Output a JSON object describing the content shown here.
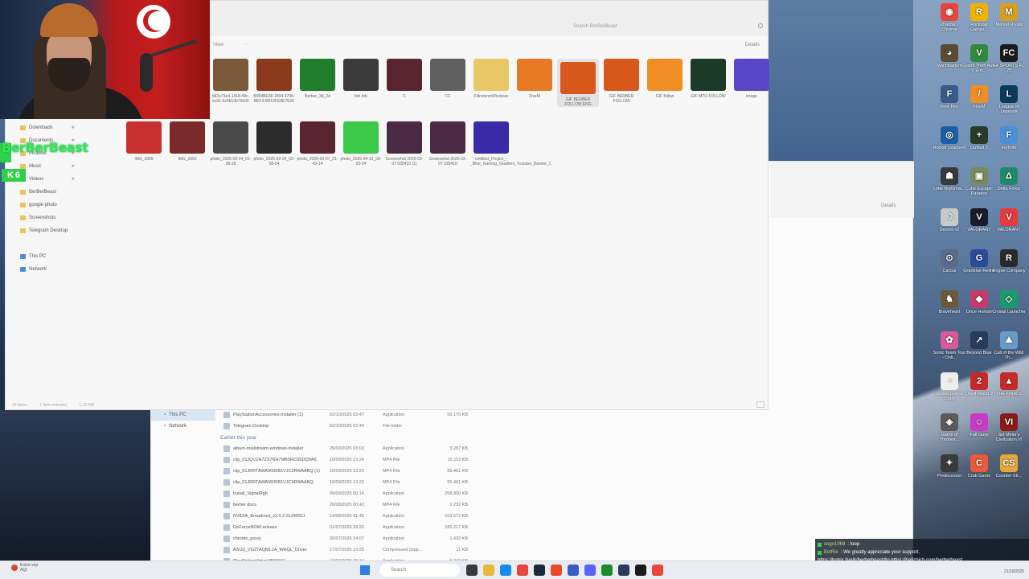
{
  "webcam": {
    "label": "streamer webcam"
  },
  "stream_overlay": {
    "name": "BerBerBeast",
    "count": "6"
  },
  "front_window": {
    "search_placeholder": "Search BerBerBeast",
    "toolbar": {
      "view": "View",
      "more": "···",
      "details": "Details"
    },
    "nav": [
      {
        "label": "Downloads",
        "pinned": true
      },
      {
        "label": "Documents",
        "pinned": true
      },
      {
        "label": "Pictures",
        "pinned": true
      },
      {
        "label": "Music",
        "pinned": true
      },
      {
        "label": "Videos",
        "pinned": true
      },
      {
        "label": "BerBerBeast",
        "pinned": false
      },
      {
        "label": "google photo",
        "pinned": false
      },
      {
        "label": "Screenshots",
        "pinned": false
      },
      {
        "label": "Telegram Desktop",
        "pinned": false
      }
    ],
    "nav_pc": "This PC",
    "nav_network": "Network",
    "status": {
      "items": "23 items",
      "selected": "1 item selected",
      "size": "1,16 MB"
    },
    "files_row1": [
      {
        "name": "b82e73e4-1418-49c-bc01-6c6b13b79b36",
        "color": "#7a5a3a"
      },
      {
        "name": "B094BE58-1504-4706-BEF3-8D10FE8E7E20",
        "color": "#8c3a1c"
      },
      {
        "name": "Berber_3d_2d",
        "color": "#1f7d2c"
      },
      {
        "name": "brb brb",
        "color": "#3a3a3a"
      },
      {
        "name": "C",
        "color": "#5a2430"
      },
      {
        "name": "CC",
        "color": "#606060"
      },
      {
        "name": "FiltrerenmWindows",
        "color": "#e9c766"
      },
      {
        "name": "FiveM",
        "color": "#e87a25"
      },
      {
        "name": "GIF BERBER FOLLOW ENG",
        "color": "#d8581c"
      },
      {
        "name": "GIF BERBER FOLLOW",
        "color": "#d8581c"
      },
      {
        "name": "GIF follow",
        "color": "#f08d24"
      },
      {
        "name": "GIF MTO FOLLOW",
        "color": "#1b3a28"
      },
      {
        "name": "image",
        "color": "#5a46c8"
      }
    ],
    "files_row2": [
      {
        "name": "IMG_2009",
        "color": "#c93030"
      },
      {
        "name": "IMG_2662",
        "color": "#7a2a2a"
      },
      {
        "name": "photo_2025-02-24_01-38-28",
        "color": "#4a4a4a"
      },
      {
        "name": "photo_2025-02-24_02-08-54",
        "color": "#2c2c2c"
      },
      {
        "name": "photo_2025-03-07_21-43-14",
        "color": "#5a2430"
      },
      {
        "name": "photo_2025-04-13_00-05-04",
        "color": "#3cc94a"
      },
      {
        "name": "Screenshot 2025-03-07 035410 (1)",
        "color": "#4a2a44"
      },
      {
        "name": "Screenshot 2025-03-07 035410",
        "color": "#4a2a44"
      },
      {
        "name": "Untitled_Project_-_Blue_Gaming_Gradient_Youtube_Banner_1",
        "color": "#3a2aa8"
      }
    ]
  },
  "back_window": {
    "details": "Details",
    "nav": [
      {
        "label": "This PC",
        "selected": true
      },
      {
        "label": "Network",
        "selected": false
      }
    ],
    "rows_top": [
      {
        "name": "PlayStationAccessories-Installer (1)",
        "date": "02/10/2025 03:47",
        "type": "Application",
        "size": "55.175 KB"
      },
      {
        "name": "Telegram Desktop",
        "date": "02/10/2025 03:44",
        "type": "File folder",
        "size": ""
      }
    ],
    "group_label": "Earlier this year",
    "rows": [
      {
        "name": "album-mailstream-windows-installer",
        "date": "25/09/2025 03:03",
        "type": "Application",
        "size": "3.287 KB"
      },
      {
        "name": "clip_01JQVZH7ZX7NH7MB5RC0SDQ0A6",
        "date": "16/09/2025 13:24",
        "type": "MP4 File",
        "size": "15.113 KB"
      },
      {
        "name": "clip_01JRRTAWA0605B1VJC5RWAABQ (1)",
        "date": "16/09/2025 13:23",
        "type": "MP4 File",
        "size": "55.461 KB"
      },
      {
        "name": "clip_01JRRTAWA0605B1VJC5RWAABQ",
        "date": "16/09/2025 13:23",
        "type": "MP4 File",
        "size": "55.461 KB"
      },
      {
        "name": "Install_SignalRgb",
        "date": "09/09/2025 00:14",
        "type": "Application",
        "size": "258.800 KB"
      },
      {
        "name": "berber docs",
        "date": "20/08/2025 00:43",
        "type": "MP4 File",
        "size": "1.232 KB"
      },
      {
        "name": "NVIDIA_Broadcast_v2.0.2.31240911",
        "date": "14/08/2025 01:45",
        "type": "Application",
        "size": "163.572 KB"
      },
      {
        "name": "GeForceNOW-release",
        "date": "01/07/2025 18:20",
        "type": "Application",
        "size": "180.217 KB"
      },
      {
        "name": "chrome_proxy",
        "date": "30/07/2025 14:07",
        "type": "Application",
        "size": "1.433 KB"
      },
      {
        "name": "ASUS_VG27AQML1A_WHQL_Driver",
        "date": "17/07/2025 13:25",
        "type": "Compressed (zipp...",
        "size": "11 KB"
      },
      {
        "name": "PlayStationVirtual-BP9101",
        "date": "13/07/2025 20:14",
        "type": "Application",
        "size": "5.342 KB"
      }
    ]
  },
  "desktop_icons": [
    {
      "label": "khanfar - Chrome",
      "icon": "chrome-icon",
      "color": "#e8453c",
      "glyph": "◉"
    },
    {
      "label": "Rockstar Games...",
      "icon": "rockstar-icon",
      "color": "#f0b400",
      "glyph": "R"
    },
    {
      "label": "Marvel Rivals",
      "icon": "marvel-rivals-icon",
      "color": "#d4a020",
      "glyph": "M"
    },
    {
      "label": "Machinarium",
      "icon": "machinarium-icon",
      "color": "#5a4a30",
      "glyph": "◕"
    },
    {
      "label": "Grand Theft Auto V Enh...",
      "icon": "gta-icon",
      "color": "#2f8a3c",
      "glyph": "V"
    },
    {
      "label": "EA SPORTS FC 25",
      "icon": "ea-fc-icon",
      "color": "#1a1a1a",
      "glyph": "FC"
    },
    {
      "label": "Free Fire",
      "icon": "free-fire-icon",
      "color": "#3a5a8a",
      "glyph": "F"
    },
    {
      "label": "FiveM",
      "icon": "fivem-icon",
      "color": "#f08d24",
      "glyph": "/"
    },
    {
      "label": "League of Legends",
      "icon": "lol-icon",
      "color": "#0d3a5a",
      "glyph": "L"
    },
    {
      "label": "Rocket League®",
      "icon": "rocket-league-icon",
      "color": "#1c5ea8",
      "glyph": "◎"
    },
    {
      "label": "Outlast 2",
      "icon": "outlast-icon",
      "color": "#2a3a2a",
      "glyph": "+"
    },
    {
      "label": "Fortnite",
      "icon": "fortnite-icon",
      "color": "#4a90d8",
      "glyph": "F"
    },
    {
      "label": "Little Nightmar...",
      "icon": "little-nightmares-icon",
      "color": "#3a3a3a",
      "glyph": "☗"
    },
    {
      "label": "Cube Escape: Paradox",
      "icon": "cube-escape-icon",
      "color": "#7a8a5a",
      "glyph": "▣"
    },
    {
      "label": "Delta Force",
      "icon": "delta-force-icon",
      "color": "#1f8a6a",
      "glyph": "Δ"
    },
    {
      "label": "Decent v2",
      "icon": "decent-icon",
      "color": "#c9c9c9",
      "glyph": "☽"
    },
    {
      "label": "VALORANT",
      "icon": "valorant-icon",
      "color": "#1a1a2a",
      "glyph": "V"
    },
    {
      "label": "VALORANT",
      "icon": "valorant-red-icon",
      "color": "#e53a3a",
      "glyph": "V"
    },
    {
      "label": "Cactus",
      "icon": "cactus-icon",
      "color": "#5a6a8a",
      "glyph": "⊙"
    },
    {
      "label": "Granblue Relink",
      "icon": "granblue-icon",
      "color": "#2a4a9a",
      "glyph": "G"
    },
    {
      "label": "Rogue Company",
      "icon": "rogue-company-icon",
      "color": "#2a2a2a",
      "glyph": "R"
    },
    {
      "label": "Braveheart",
      "icon": "braveheart-icon",
      "color": "#6a5a3a",
      "glyph": "♞"
    },
    {
      "label": "Once Human",
      "icon": "once-human-icon",
      "color": "#c73a6a",
      "glyph": "◆"
    },
    {
      "label": "Crystal Launcher",
      "icon": "crystal-icon",
      "color": "#1a9a6a",
      "glyph": "◇"
    },
    {
      "label": "Sonic Team Tour - Onli...",
      "icon": "sonic-icon",
      "color": "#d85a9a",
      "glyph": "✿"
    },
    {
      "label": "Beyond Blue",
      "icon": "beyond-blue-icon",
      "color": "#2a3a5a",
      "glyph": "↗"
    },
    {
      "label": "Call of the Wild Th...",
      "icon": "call-of-wild-icon",
      "color": "#6a9ac8",
      "glyph": "⛰"
    },
    {
      "label": "Goose Goose Duck",
      "icon": "goose-icon",
      "color": "#eeeeee",
      "glyph": "◔"
    },
    {
      "label": "Dead Island 2",
      "icon": "dead-island-icon",
      "color": "#c42a2a",
      "glyph": "2"
    },
    {
      "label": "THE FINALS",
      "icon": "the-finals-icon",
      "color": "#c42a2a",
      "glyph": "▲"
    },
    {
      "label": "Game of Thrones...",
      "icon": "got-icon",
      "color": "#5a5a5a",
      "glyph": "◈"
    },
    {
      "label": "Fall Guys",
      "icon": "fall-guys-icon",
      "color": "#c83ac8",
      "glyph": "☺"
    },
    {
      "label": "Sid Meier's Civilization VI",
      "icon": "civ-icon",
      "color": "#8a1a1a",
      "glyph": "VI"
    },
    {
      "label": "Predecessor",
      "icon": "predecessor-icon",
      "color": "#3a3a3a",
      "glyph": "✦"
    },
    {
      "label": "Crab Game",
      "icon": "crab-game-icon",
      "color": "#e85a3a",
      "glyph": "C"
    },
    {
      "label": "Counter-Str...",
      "icon": "counter-strike-icon",
      "color": "#e8a63a",
      "glyph": "CS"
    }
  ],
  "chat": {
    "line1_name": "sogo1069",
    "line1_msg": ": loop",
    "line2_name": "BotRix",
    "line2_msg": ": We greatly appreciate your support.",
    "line3": "https://botrix.live/k/berberbeast/tip https://ba9chich.com/berberbeast"
  },
  "taskbar": {
    "weather": "Kokot vejr",
    "weather_sub": "AQI",
    "search": "Search",
    "clock_time": "",
    "clock_date": "21/10/2025",
    "apps": [
      {
        "icon": "file-manager-icon",
        "color": "#3a3a3a"
      },
      {
        "icon": "explorer-icon",
        "color": "#e8b83a"
      },
      {
        "icon": "edge-icon",
        "color": "#1a8ae8"
      },
      {
        "icon": "chrome-icon",
        "color": "#e8453c"
      },
      {
        "icon": "steam-icon",
        "color": "#1a2a3a"
      },
      {
        "icon": "ea-icon",
        "color": "#e84a2a"
      },
      {
        "icon": "mail-icon",
        "color": "#3a5ac8"
      },
      {
        "icon": "discord-icon",
        "color": "#5865f2"
      },
      {
        "icon": "xbox-icon",
        "color": "#1a8a2a"
      },
      {
        "icon": "steam2-icon",
        "color": "#2a3a5a"
      },
      {
        "icon": "obs-icon",
        "color": "#1a1a1a"
      },
      {
        "icon": "chrome2-icon",
        "color": "#e8453c"
      }
    ]
  }
}
